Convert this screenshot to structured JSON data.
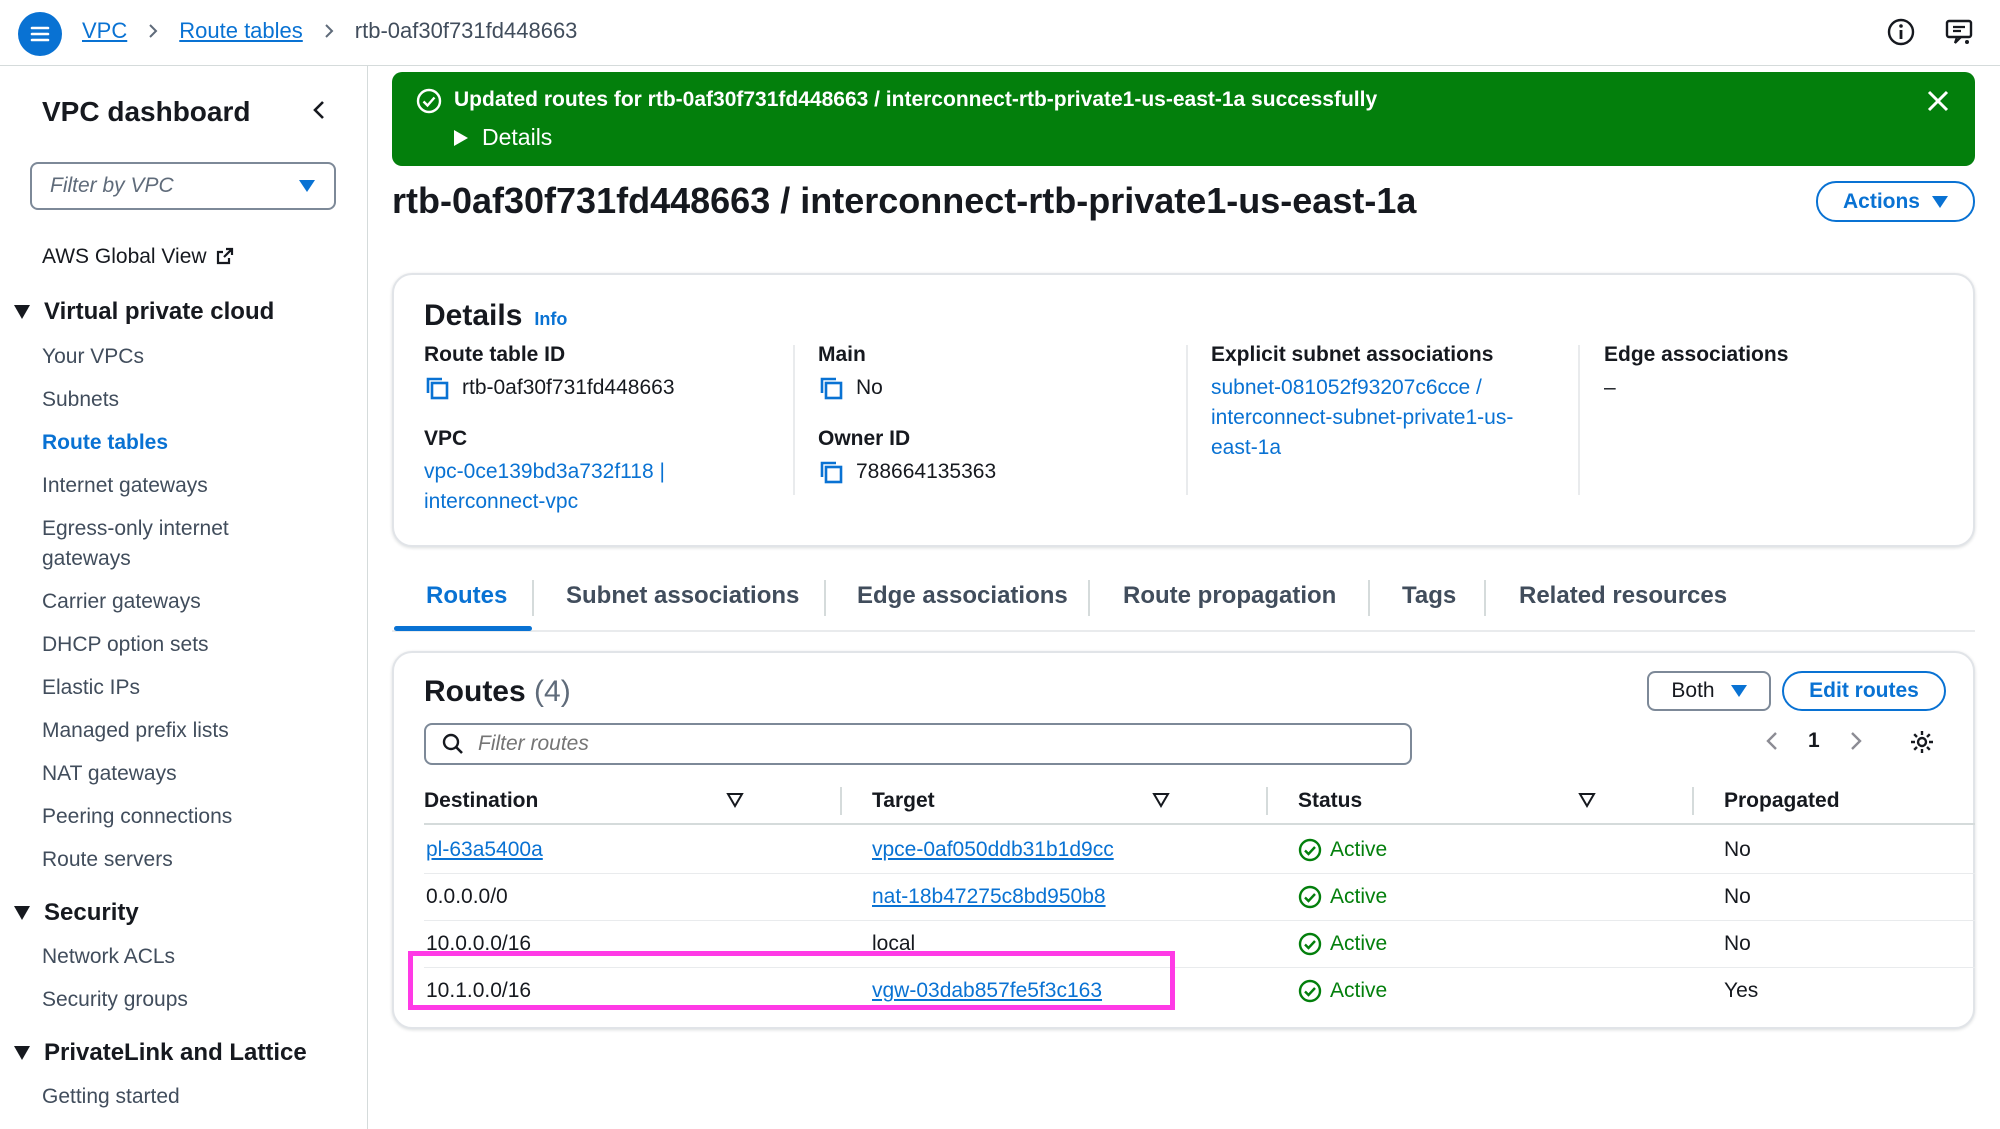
{
  "breadcrumb": [
    "VPC",
    "Route tables",
    "rtb-0af30f731fd448663"
  ],
  "sidebar": {
    "title": "VPC dashboard",
    "filter_placeholder": "Filter by VPC",
    "global_view": "AWS Global View",
    "sections": [
      {
        "label": "Virtual private cloud",
        "items": [
          "Your VPCs",
          "Subnets",
          "Route tables",
          "Internet gateways",
          "Egress-only internet gateways",
          "Carrier gateways",
          "DHCP option sets",
          "Elastic IPs",
          "Managed prefix lists",
          "NAT gateways",
          "Peering connections",
          "Route servers"
        ]
      },
      {
        "label": "Security",
        "items": [
          "Network ACLs",
          "Security groups"
        ]
      },
      {
        "label": "PrivateLink and Lattice",
        "items": [
          "Getting started"
        ]
      }
    ],
    "active_item": "Route tables"
  },
  "flash": {
    "message": "Updated routes for rtb-0af30f731fd448663 / interconnect-rtb-private1-us-east-1a successfully",
    "details_label": "Details"
  },
  "page_title": "rtb-0af30f731fd448663 / interconnect-rtb-private1-us-east-1a",
  "actions_label": "Actions",
  "details": {
    "title": "Details",
    "info": "Info",
    "route_table_id_label": "Route table ID",
    "route_table_id": "rtb-0af30f731fd448663",
    "vpc_label": "VPC",
    "vpc_line1": "vpc-0ce139bd3a732f118 |",
    "vpc_line2": "interconnect-vpc",
    "main_label": "Main",
    "main_value": "No",
    "owner_label": "Owner ID",
    "owner_value": "788664135363",
    "subnet_assoc_label": "Explicit subnet associations",
    "subnet_assoc_line1": "subnet-081052f93207c6cce /",
    "subnet_assoc_line2": "interconnect-subnet-private1-us-",
    "subnet_assoc_line3": "east-1a",
    "edge_label": "Edge associations",
    "edge_value": "–"
  },
  "tabs": [
    "Routes",
    "Subnet associations",
    "Edge associations",
    "Route propagation",
    "Tags",
    "Related resources"
  ],
  "active_tab": "Routes",
  "routes": {
    "title": "Routes",
    "count": "(4)",
    "both_label": "Both",
    "edit_label": "Edit routes",
    "filter_placeholder": "Filter routes",
    "page": "1",
    "columns": [
      "Destination",
      "Target",
      "Status",
      "Propagated"
    ],
    "rows": [
      {
        "destination": "pl-63a5400a",
        "destination_link": true,
        "target": "vpce-0af050ddb31b1d9cc",
        "target_link": true,
        "status": "Active",
        "propagated": "No"
      },
      {
        "destination": "0.0.0.0/0",
        "destination_link": false,
        "target": "nat-18b47275c8bd950b8",
        "target_link": true,
        "status": "Active",
        "propagated": "No"
      },
      {
        "destination": "10.0.0.0/16",
        "destination_link": false,
        "target": "local",
        "target_link": false,
        "status": "Active",
        "propagated": "No"
      },
      {
        "destination": "10.1.0.0/16",
        "destination_link": false,
        "target": "vgw-03dab857fe5f3c163",
        "target_link": true,
        "status": "Active",
        "propagated": "Yes"
      }
    ]
  },
  "colors": {
    "link": "#0972d3",
    "success_flash": "#037f0c",
    "status_active": "#037f0c",
    "highlight_box": "#ff3ae6"
  },
  "icons": {
    "menu": "menu-icon",
    "info": "info-icon",
    "feedback": "feedback-icon",
    "copy": "copy-icon",
    "status": "check-circle-icon",
    "settings": "gear-icon"
  }
}
